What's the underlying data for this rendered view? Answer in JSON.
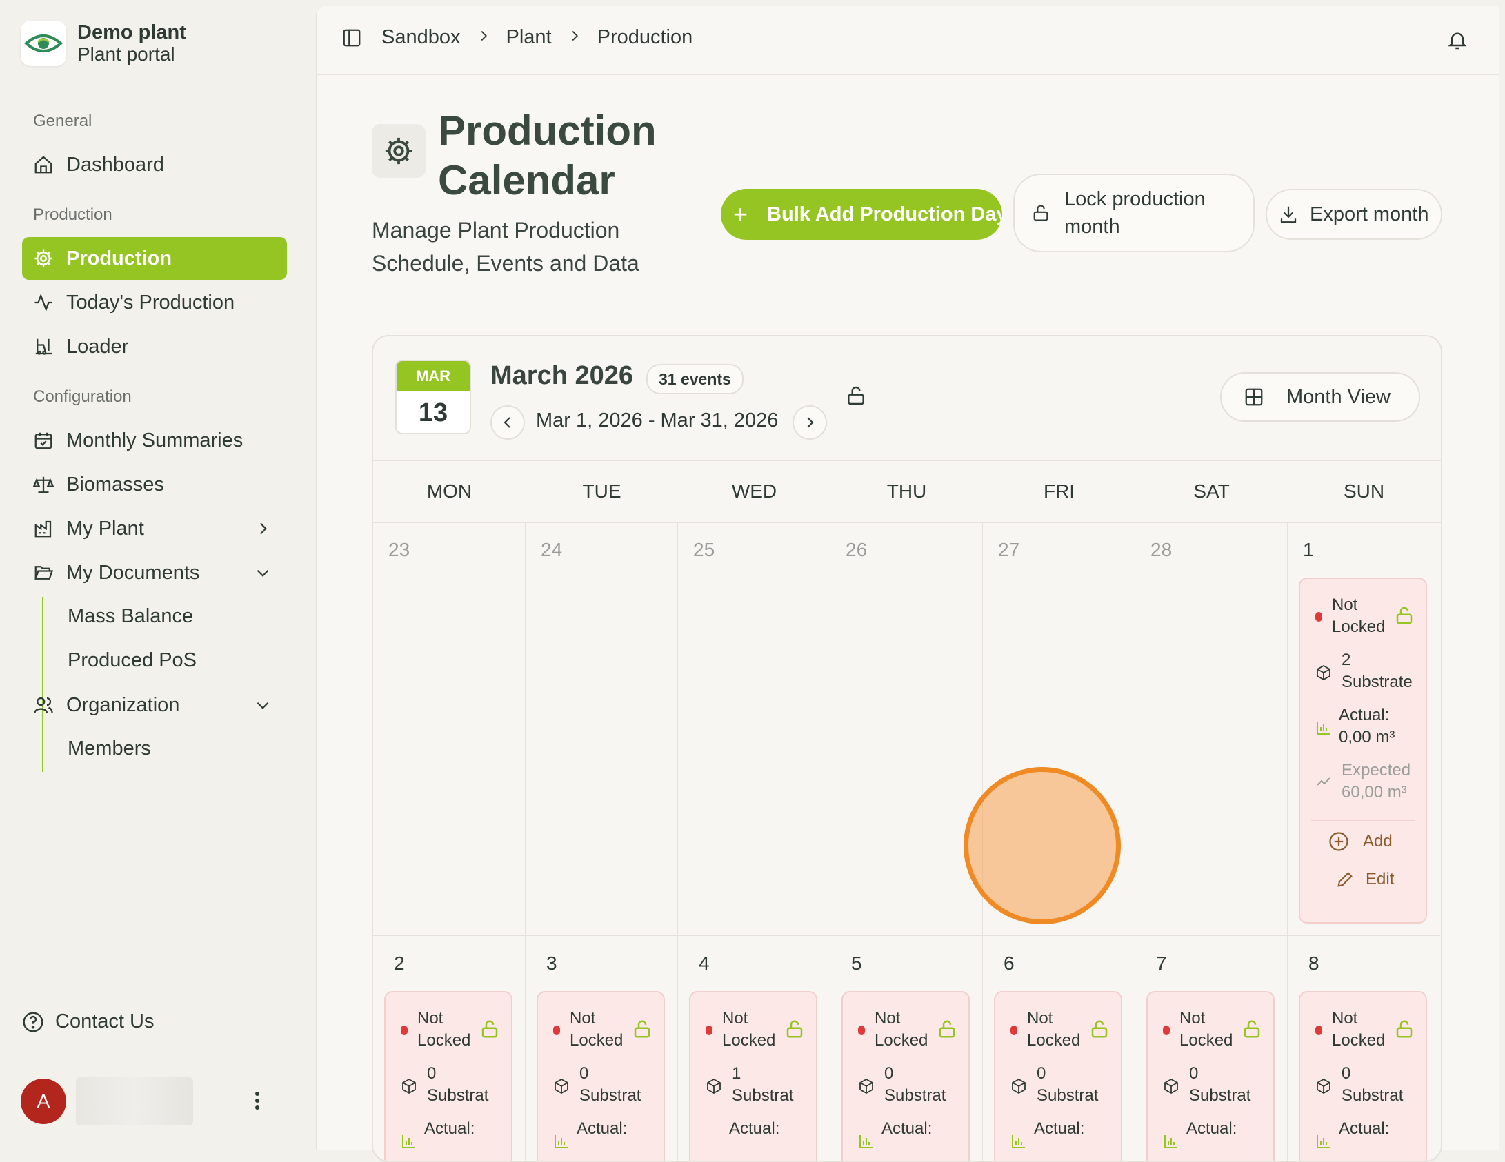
{
  "brand": {
    "name": "Demo plant",
    "subtitle": "Plant portal"
  },
  "sidebar": {
    "sections": {
      "general": "General",
      "production": "Production",
      "configuration": "Configuration"
    },
    "items": {
      "dashboard": "Dashboard",
      "production": "Production",
      "todays_production": "Today's Production",
      "loader": "Loader",
      "monthly_summaries": "Monthly Summaries",
      "biomasses": "Biomasses",
      "my_plant": "My Plant",
      "my_documents": "My Documents",
      "mass_balance": "Mass Balance",
      "produced_pos": "Produced PoS",
      "organization": "Organization",
      "members": "Members"
    },
    "contact": "Contact Us",
    "user_initial": "A"
  },
  "breadcrumb": [
    "Sandbox",
    "Plant",
    "Production"
  ],
  "page": {
    "title": "Production Calendar",
    "subtitle": "Manage Plant Production Schedule, Events and Data",
    "bulk_add": "Bulk Add Production Days",
    "lock_month": "Lock production month",
    "export_month": "Export month"
  },
  "calendar": {
    "badge_month": "MAR",
    "badge_day": "13",
    "month_title": "March 2026",
    "events_count": "31 events",
    "range": "Mar 1, 2026 - Mar 31, 2026",
    "view": "Month View",
    "weekdays": [
      "MON",
      "TUE",
      "WED",
      "THU",
      "FRI",
      "SAT",
      "SUN"
    ],
    "week1": [
      "23",
      "24",
      "25",
      "26",
      "27",
      "28",
      "1"
    ],
    "week2": [
      "2",
      "3",
      "4",
      "5",
      "6",
      "7",
      "8"
    ],
    "event_status": [
      "Not",
      "Locked"
    ],
    "substrate_word": "Substrat",
    "actual_label": "Actual:",
    "day1": {
      "substrates": "2",
      "substrate_word": "Substrate",
      "actual_value": "0,00 m³",
      "expected_label": "Expected",
      "expected_value": "60,00 m³",
      "add": "Add",
      "edit": "Edit"
    },
    "week2_substrates": [
      "0",
      "0",
      "1",
      "0",
      "0",
      "0",
      "0"
    ]
  },
  "colors": {
    "accent": "#95c522",
    "status_red": "#e0393a",
    "highlight": "#f08a24"
  }
}
